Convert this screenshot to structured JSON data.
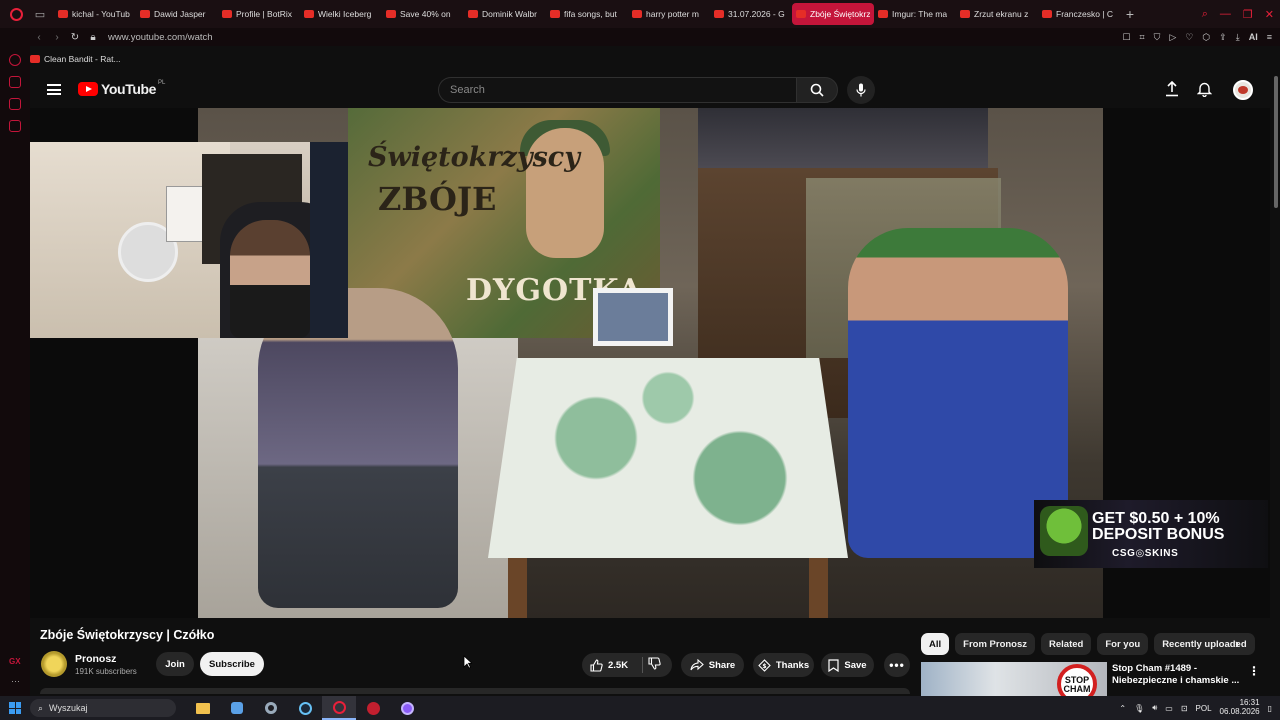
{
  "browser": {
    "tabs": [
      {
        "label": "kichal - YouTub",
        "active": false
      },
      {
        "label": "Dawid Jasper",
        "active": false
      },
      {
        "label": "Profile | BotRix",
        "active": false
      },
      {
        "label": "Wielki Iceberg",
        "active": false
      },
      {
        "label": "Save 40% on",
        "active": false
      },
      {
        "label": "Dominik Walbr",
        "active": false
      },
      {
        "label": "fifa songs, but",
        "active": false
      },
      {
        "label": "harry potter m",
        "active": false
      },
      {
        "label": "31.07.2026 - G",
        "active": false
      },
      {
        "label": "Zbóje Świętokrzysc",
        "active": true
      },
      {
        "label": "Imgur: The ma",
        "active": false
      },
      {
        "label": "Zrzut ekranu z",
        "active": false
      },
      {
        "label": "Franczesko | C",
        "active": false
      }
    ],
    "new_tab": "+",
    "url": "www.youtube.com/watch",
    "bookmark": "Clean Bandit - Rat...",
    "ai_label": "AI",
    "gx_label": "GX"
  },
  "youtube": {
    "logo_text": "YouTube",
    "region": "PL",
    "search_placeholder": "Search"
  },
  "video": {
    "mural_line1": "Świętokrzyscy",
    "mural_line2": "ZBÓJE",
    "mural_line3": "DYGOTKA",
    "ad_line1": "GET $0.50 + 10%",
    "ad_line2": "DEPOSIT BONUS",
    "ad_brand": "CSG◎SKINS",
    "title": "Zbóje Świętokrzyscy | Czółko",
    "channel": "Pronosz",
    "subscribers": "191K subscribers",
    "join_label": "Join",
    "subscribe_label": "Subscribe",
    "likes": "2.5K",
    "share_label": "Share",
    "thanks_label": "Thanks",
    "save_label": "Save"
  },
  "recommendations": {
    "chips": [
      "All",
      "From Pronosz",
      "Related",
      "For you",
      "Recently uploaded"
    ],
    "first_title": "Stop Cham #1489 - Niebezpieczne i chamskie ...",
    "thumb_text": "STOP CHAM"
  },
  "taskbar": {
    "search_placeholder": "Wyszukaj",
    "lang": "POL",
    "time": "16:31",
    "date": "06.08.2026"
  },
  "colors": {
    "accent": "#c4153a",
    "yt_red": "#ff0000",
    "background": "#0f0f0f"
  }
}
